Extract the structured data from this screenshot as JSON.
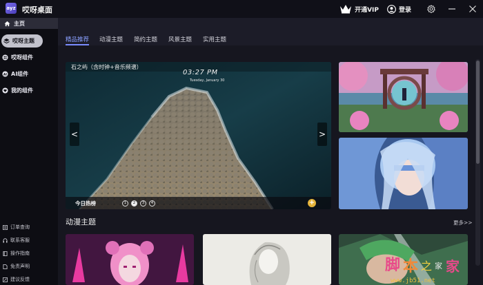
{
  "app": {
    "title": "哎呀桌面",
    "logo_text": "ayz"
  },
  "topbar": {
    "vip_label": "开通VIP",
    "login_label": "登录"
  },
  "sidebar": {
    "home": "主页",
    "items": [
      {
        "label": "哎呀主题",
        "active": true
      },
      {
        "label": "哎呀组件",
        "active": false
      },
      {
        "label": "AI组件",
        "active": false
      },
      {
        "label": "我的组件",
        "active": false
      }
    ],
    "bottom_items": [
      "订单查询",
      "联系客服",
      "操作指南",
      "免责声明",
      "建议反馈"
    ]
  },
  "tabs": [
    {
      "label": "精品推荐",
      "active": true
    },
    {
      "label": "动漫主题",
      "active": false
    },
    {
      "label": "简约主题",
      "active": false
    },
    {
      "label": "风景主题",
      "active": false
    },
    {
      "label": "实用主题",
      "active": false
    }
  ],
  "banner": {
    "title": "石之屿（含时钟+音乐频谱）",
    "clock": "03:27 PM",
    "date": "Tuesday, January 30",
    "hot_label": "今日热榜",
    "pages": [
      "1",
      "2",
      "3",
      "4"
    ],
    "active_page": 1,
    "prev_arrow": "<",
    "next_arrow": ">",
    "add_label": "+"
  },
  "section": {
    "title": "动漫主题",
    "more_label": "更多>>"
  },
  "colors": {
    "accent": "#7b8cff",
    "vip_gold": "#e4b43a",
    "active_nav": "#c2c2cc"
  }
}
